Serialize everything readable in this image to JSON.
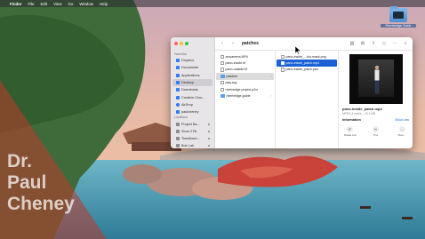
{
  "menubar": {
    "apple_icon": "apple-icon",
    "items": [
      "Finder",
      "File",
      "Edit",
      "View",
      "Go",
      "Window",
      "Help"
    ]
  },
  "watermark": {
    "lines": [
      "Dr.",
      "Paul",
      "Cheney"
    ]
  },
  "desktop_icon": {
    "label": "Riverbridge Guide"
  },
  "finder": {
    "title": "patches",
    "sidebar": {
      "sections": [
        {
          "title": "Favorites",
          "items": [
            {
              "label": "Dropbox",
              "icon": "dropbox-icon",
              "color": "#2f7cf6"
            },
            {
              "label": "Documents",
              "icon": "document-icon",
              "color": "#2f7cf6"
            },
            {
              "label": "Applications",
              "icon": "applications-icon",
              "color": "#2f7cf6"
            },
            {
              "label": "Desktop",
              "icon": "desktop-icon",
              "color": "#2f7cf6",
              "selected": true
            },
            {
              "label": "Downloads",
              "icon": "downloads-icon",
              "color": "#2f7cf6"
            },
            {
              "label": "Creative Clou...",
              "icon": "creative-cloud-icon",
              "color": "#2f7cf6"
            },
            {
              "label": "AirDrop",
              "icon": "airdrop-icon",
              "color": "#2f7cf6"
            },
            {
              "label": "paulcheney",
              "icon": "home-icon",
              "color": "#2f7cf6"
            }
          ]
        },
        {
          "title": "Locations",
          "items": [
            {
              "label": "Project Ba...",
              "icon": "drive-icon",
              "color": "#8a8a8f"
            },
            {
              "label": "Store 2TB",
              "icon": "drive-icon",
              "color": "#8a8a8f"
            },
            {
              "label": "TimeMach...",
              "icon": "drive-icon",
              "color": "#8a8a8f"
            },
            {
              "label": "Bob Lab",
              "icon": "drive-icon",
              "color": "#8a8a8f"
            }
          ]
        }
      ]
    },
    "column1": [
      {
        "name": "amcamera.MP4",
        "kind": "file"
      },
      {
        "name": "pano-inside.tif",
        "kind": "file"
      },
      {
        "name": "pano-outside.tif",
        "kind": "file"
      },
      {
        "name": "patches",
        "kind": "folder",
        "selected": true
      },
      {
        "name": "play.svg",
        "kind": "file"
      },
      {
        "name": "riverbridge project.p2vr",
        "kind": "file"
      },
      {
        "name": "riverbridge-guide",
        "kind": "folder"
      }
    ],
    "column2": [
      {
        "name": "pano-inside_...tch-mask.png",
        "kind": "file"
      },
      {
        "name": "pano-inside_patch.mp4",
        "kind": "file",
        "selected": true
      },
      {
        "name": "pano-inside_patch.psd",
        "kind": "file"
      }
    ],
    "preview": {
      "filename": "pano-inside_patch.mp4",
      "meta": "MPEG-4 movie – 23.1 MB",
      "info_label": "Information",
      "show_less": "Show Less",
      "actions": [
        {
          "label": "Rotate Left",
          "icon": "rotate-left-icon",
          "glyph": "↺"
        },
        {
          "label": "Trim",
          "icon": "trim-icon",
          "glyph": "✂"
        },
        {
          "label": "More...",
          "icon": "more-icon",
          "glyph": "…"
        }
      ]
    }
  },
  "colors": {
    "accent": "#1a62d6",
    "folder": "#5aa0e6"
  }
}
